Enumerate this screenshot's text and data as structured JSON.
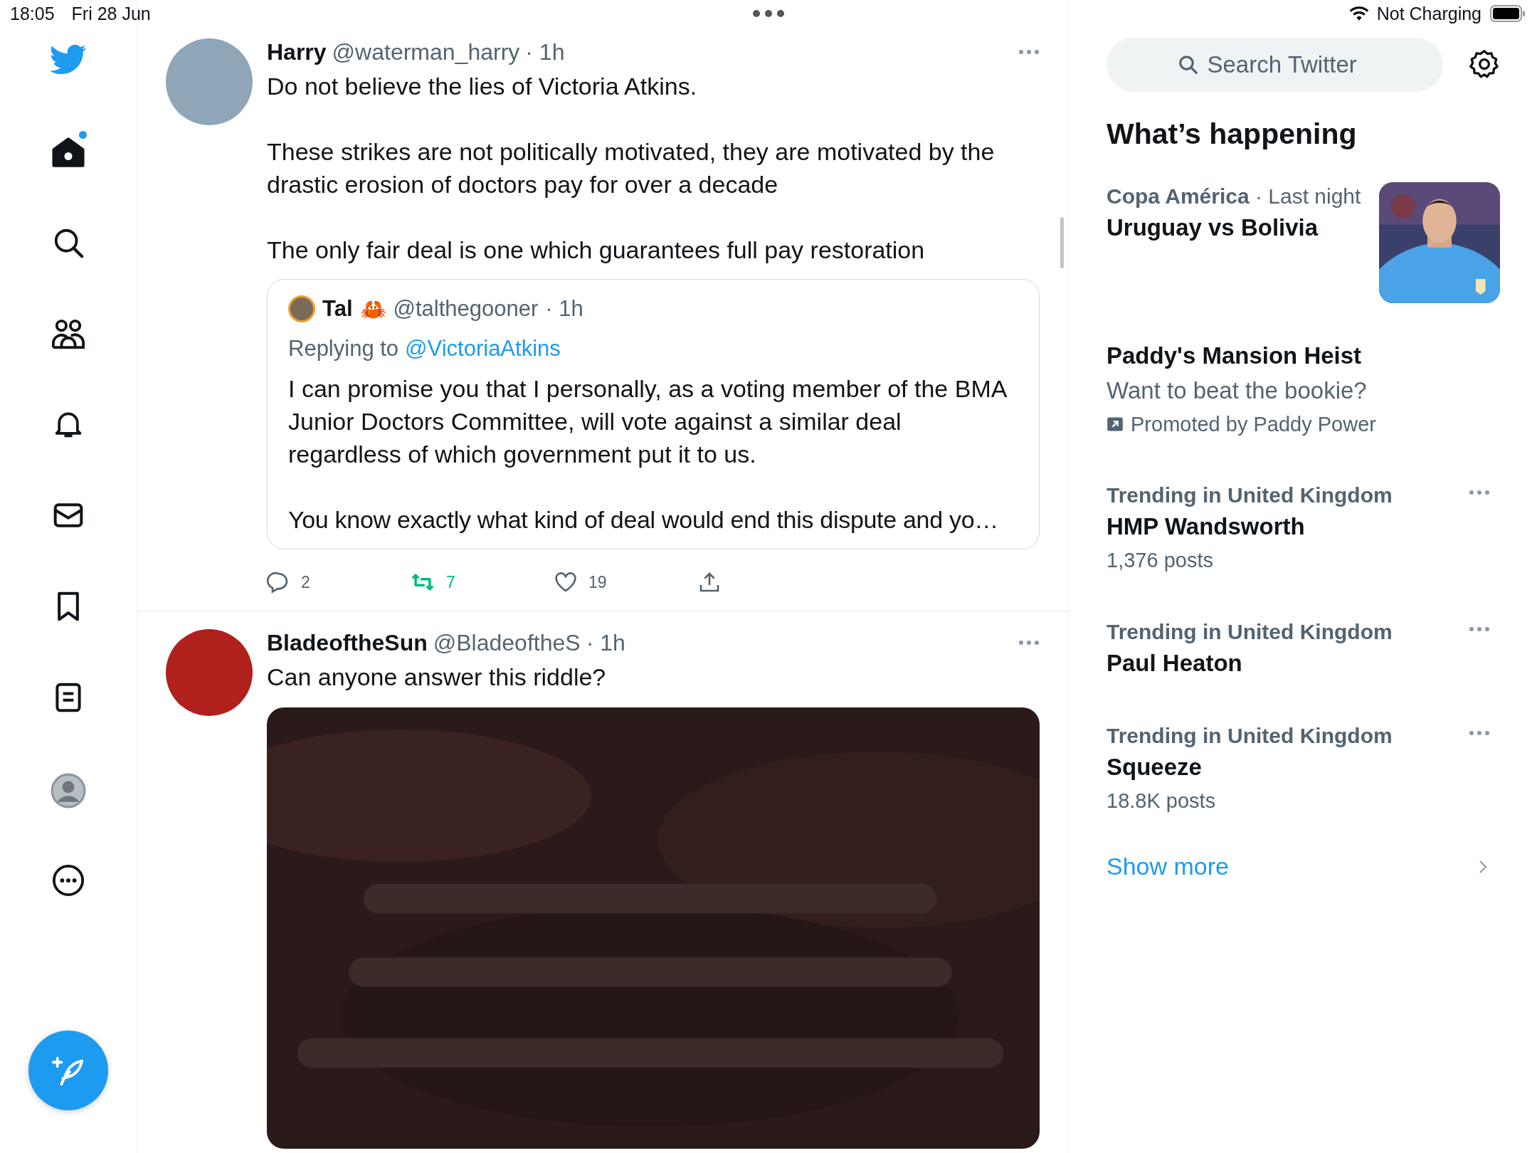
{
  "status_bar": {
    "time": "18:05",
    "date": "Fri 28 Jun",
    "battery": "Not Charging"
  },
  "nav": [
    {
      "kind": "home",
      "selected": true,
      "has_new": true
    },
    {
      "kind": "search",
      "selected": false,
      "has_new": false
    },
    {
      "kind": "communities",
      "selected": false,
      "has_new": false
    },
    {
      "kind": "notifications",
      "selected": false,
      "has_new": false
    },
    {
      "kind": "messages",
      "selected": false,
      "has_new": false
    },
    {
      "kind": "bookmarks",
      "selected": false,
      "has_new": false
    },
    {
      "kind": "lists",
      "selected": false,
      "has_new": false
    },
    {
      "kind": "more",
      "selected": false,
      "has_new": false
    }
  ],
  "tweets": [
    {
      "name": "Harry",
      "handle": "@waterman_harry",
      "time": "· 1h",
      "paragraphs": [
        "Do not believe the lies of Victoria Atkins.",
        "These strikes are not politically motivated, they are motivated by the drastic erosion of doctors pay for over a decade",
        "The only fair deal is one which guarantees full pay restoration"
      ],
      "quote": {
        "name": "Tal",
        "emoji": "🦀",
        "handle": "@talthegooner",
        "time": "· 1h",
        "replying_label": "Replying to",
        "replying_to": "@VictoriaAtkins",
        "paragraphs": [
          "I can promise you that I personally, as a voting member of the BMA Junior Doctors Committee, will vote against a similar deal regardless of which government put it to us.",
          "You know exactly what kind of deal would end this dispute and yo…"
        ]
      },
      "replies": "2",
      "retweets": "7",
      "retweeted": true,
      "likes": "19",
      "liked": false
    },
    {
      "name": "BladeoftheSun",
      "handle": "@BladeoftheS",
      "time": "· 1h",
      "paragraphs": [
        "Can anyone answer this riddle?"
      ],
      "media": {
        "kind": "picture"
      }
    }
  ],
  "search": {
    "placeholder": "Search Twitter"
  },
  "trends_title": "What’s happening",
  "trends": [
    {
      "kind": "event",
      "context": "Copa América",
      "meta": "· Last night",
      "title": "Uruguay vs Bolivia",
      "picture": true
    },
    {
      "kind": "promoted",
      "title": "Paddy's Mansion Heist",
      "subtitle": "Want to beat the bookie?",
      "promoted_by": "Promoted by Paddy Power"
    },
    {
      "kind": "trend",
      "context": "Trending in United Kingdom",
      "title": "HMP Wandsworth",
      "count": "1,376 posts"
    },
    {
      "kind": "trend",
      "context": "Trending in United Kingdom",
      "title": "Paul Heaton"
    },
    {
      "kind": "trend",
      "context": "Trending in United Kingdom",
      "title": "Squeeze",
      "count": "18.8K posts"
    }
  ],
  "show_more": "Show more"
}
